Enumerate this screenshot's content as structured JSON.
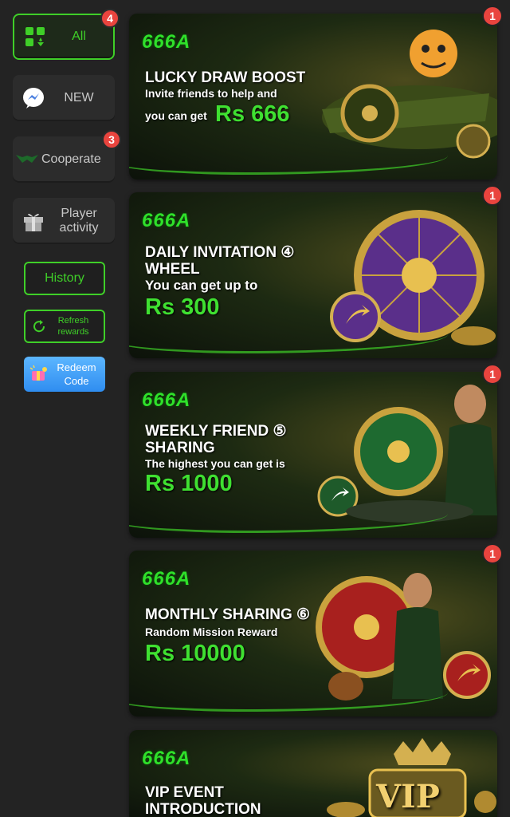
{
  "sidebar": {
    "items": [
      {
        "label": "All",
        "badge": "4",
        "icon": "grid-icon"
      },
      {
        "label": "NEW",
        "icon": "messenger-icon"
      },
      {
        "label": "Cooperate",
        "badge": "3",
        "icon": "handshake-icon"
      },
      {
        "label": "Player activity",
        "icon": "gift-icon"
      }
    ],
    "history_label": "History",
    "refresh_label": "Refresh rewards",
    "redeem_label": "Redeem Code"
  },
  "banners": [
    {
      "logo": "666A",
      "title": "LUCKY DRAW BOOST",
      "subtitle": "Invite friends to help and",
      "prefix": "you can get",
      "amount": "Rs 666",
      "badge": "1"
    },
    {
      "logo": "666A",
      "title": "DAILY INVITATION ④ WHEEL",
      "subtitle": "You can get up to",
      "amount": "Rs 300",
      "badge": "1"
    },
    {
      "logo": "666A",
      "title": "WEEKLY FRIEND ⑤ SHARING",
      "subtitle": "The highest you can get is",
      "amount": "Rs 1000",
      "badge": "1"
    },
    {
      "logo": "666A",
      "title": "MONTHLY SHARING ⑥",
      "subtitle": "Random Mission Reward",
      "amount": "Rs 10000",
      "badge": "1"
    },
    {
      "logo": "666A",
      "title": "VIP EVENT INTRODUCTION",
      "art_text": "VIP"
    }
  ],
  "colors": {
    "accent": "#3fcf28",
    "badge": "#e9443e",
    "background": "#232323"
  }
}
